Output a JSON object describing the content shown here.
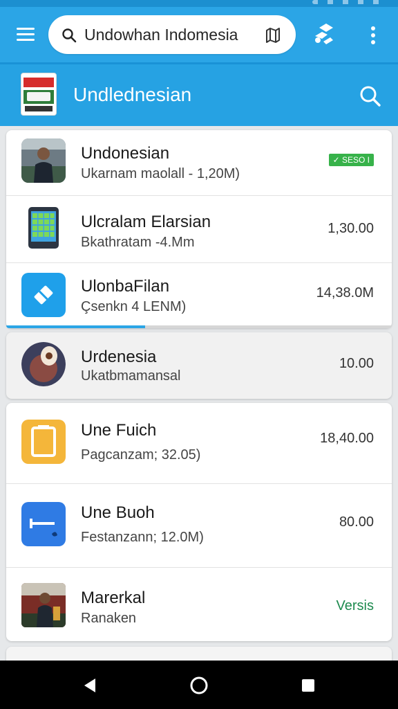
{
  "header": {
    "search": {
      "value": "Undowhan Indomesia",
      "placeholder": ""
    },
    "icons": {
      "menu": "menu-icon",
      "search": "search-icon",
      "map": "map-icon",
      "share": "share-icon",
      "more": "more-vert-icon"
    }
  },
  "subheader": {
    "title": "Undlednesian",
    "search_icon": "search-icon"
  },
  "list": {
    "group1": [
      {
        "name": "Undonesian",
        "meta": "Ukarnam maolall - 1,20M)",
        "badge": "✓ SESO I"
      },
      {
        "name": "Ulcralam Elarsian",
        "meta": "Bkathratam -4.Mm",
        "value": "1,30.00"
      },
      {
        "name": "UlonbaFilan",
        "meta": "Çsenkn 4 LENM)",
        "value": "14,38.0M",
        "progress": 0.36
      }
    ],
    "group2": [
      {
        "name": "Urdenesia",
        "meta": "Ukatbmamansal",
        "value": "10.00"
      }
    ],
    "group3": [
      {
        "name": "Une Fuich",
        "meta": "Pagcanzam; 32.05)",
        "value": "18,40.00"
      },
      {
        "name": "Une Buoh",
        "meta": "Festanzann; 12.0M)",
        "value": "80.00"
      },
      {
        "name": "Marerkal",
        "meta": "Ranaken",
        "value": "Versis"
      }
    ]
  },
  "colors": {
    "primary": "#2ba5e6",
    "badge_green": "#37b24a",
    "link_green": "#1d8a4e"
  },
  "navbar": {
    "icons": [
      "back-icon",
      "home-icon",
      "recents-icon"
    ]
  }
}
